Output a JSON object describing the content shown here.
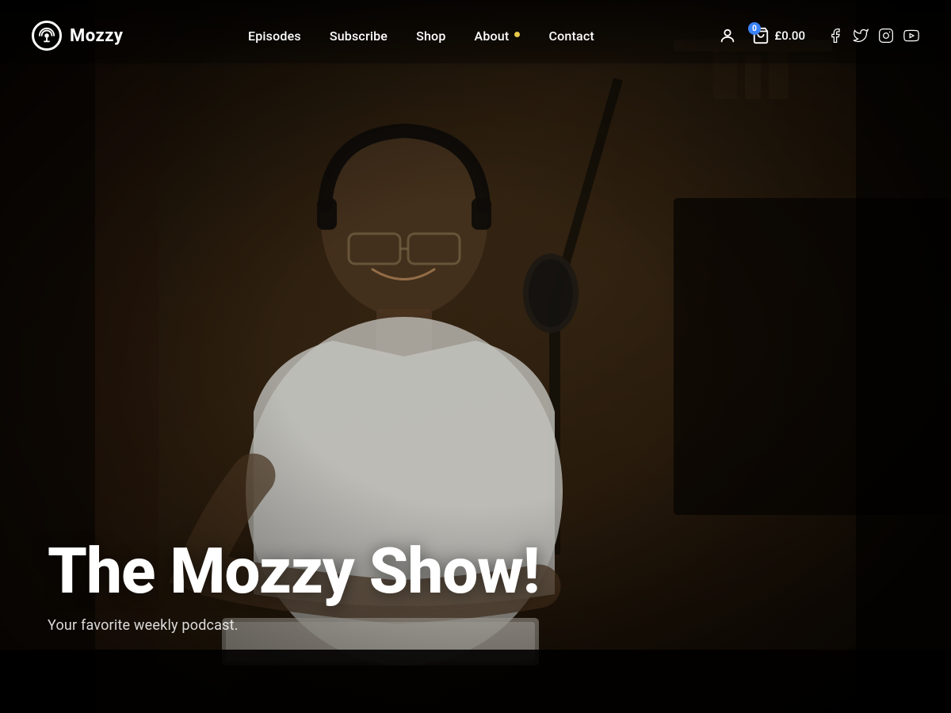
{
  "site": {
    "logo_text": "Mozzy",
    "hero_title": "The Mozzy Show!",
    "hero_subtitle": "Your favorite weekly podcast."
  },
  "nav": {
    "links": [
      {
        "label": "Episodes",
        "id": "episodes"
      },
      {
        "label": "Subscribe",
        "id": "subscribe"
      },
      {
        "label": "Shop",
        "id": "shop"
      },
      {
        "label": "About",
        "id": "about"
      },
      {
        "label": "Contact",
        "id": "contact"
      }
    ]
  },
  "cart": {
    "count": "0",
    "price": "£0.00"
  },
  "colors": {
    "accent": "#e8c84a",
    "badge": "#3b82f6",
    "text_primary": "#ffffff",
    "bg_dark": "#1a1008"
  },
  "social": [
    {
      "name": "facebook",
      "label": "Facebook"
    },
    {
      "name": "twitter",
      "label": "Twitter"
    },
    {
      "name": "instagram",
      "label": "Instagram"
    },
    {
      "name": "youtube",
      "label": "YouTube"
    }
  ]
}
